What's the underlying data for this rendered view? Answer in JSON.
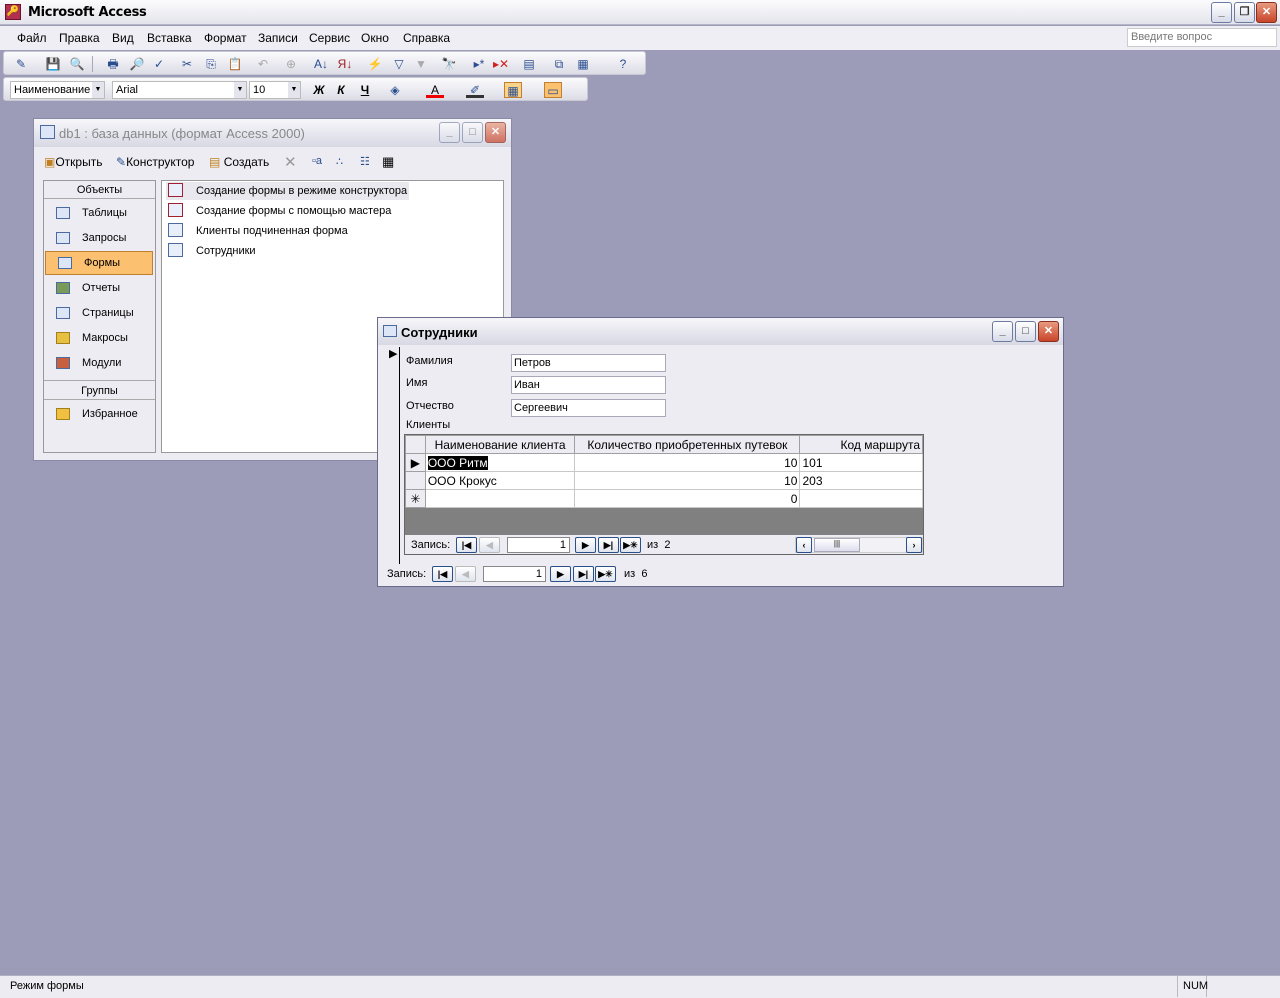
{
  "app": {
    "title": "Microsoft Access"
  },
  "menu": [
    "Файл",
    "Правка",
    "Вид",
    "Вставка",
    "Формат",
    "Записи",
    "Сервис",
    "Окно",
    "Справка"
  ],
  "ask_placeholder": "Введите вопрос",
  "format_toolbar": {
    "object": "Наименование",
    "font": "Arial",
    "size": "10",
    "bold": "Ж",
    "italic": "К",
    "underline": "Ч"
  },
  "db_window": {
    "title": "db1 : база данных (формат Access 2000)",
    "toolbar": {
      "open": "Открыть",
      "design": "Конструктор",
      "create": "Создать"
    },
    "objects_header": "Объекты",
    "objects": [
      "Таблицы",
      "Запросы",
      "Формы",
      "Отчеты",
      "Страницы",
      "Макросы",
      "Модули"
    ],
    "selected_object": "Формы",
    "groups_header": "Группы",
    "groups": [
      "Избранное"
    ],
    "items": [
      "Создание формы в режиме конструктора",
      "Создание формы с помощью мастера",
      "Клиенты подчиненная форма",
      "Сотрудники"
    ]
  },
  "form_window": {
    "title": "Сотрудники",
    "fields": [
      {
        "label": "Фамилия",
        "value": "Петров"
      },
      {
        "label": "Имя",
        "value": "Иван"
      },
      {
        "label": "Отчество",
        "value": "Сергеевич"
      }
    ],
    "subform_label": "Клиенты",
    "columns": [
      "Наименование клиента",
      "Количество приобретенных путевок",
      "Код маршрута"
    ],
    "rows": [
      [
        "ООО Ритм",
        "10",
        "101"
      ],
      [
        "ООО Крокус",
        "10",
        "203"
      ],
      [
        "",
        "0",
        ""
      ]
    ],
    "sub_nav": {
      "label": "Запись:",
      "current": "1",
      "of": "из",
      "total": "2"
    },
    "main_nav": {
      "label": "Запись:",
      "current": "1",
      "of": "из",
      "total": "6"
    }
  },
  "status": {
    "left": "Режим формы",
    "num": "NUM"
  }
}
